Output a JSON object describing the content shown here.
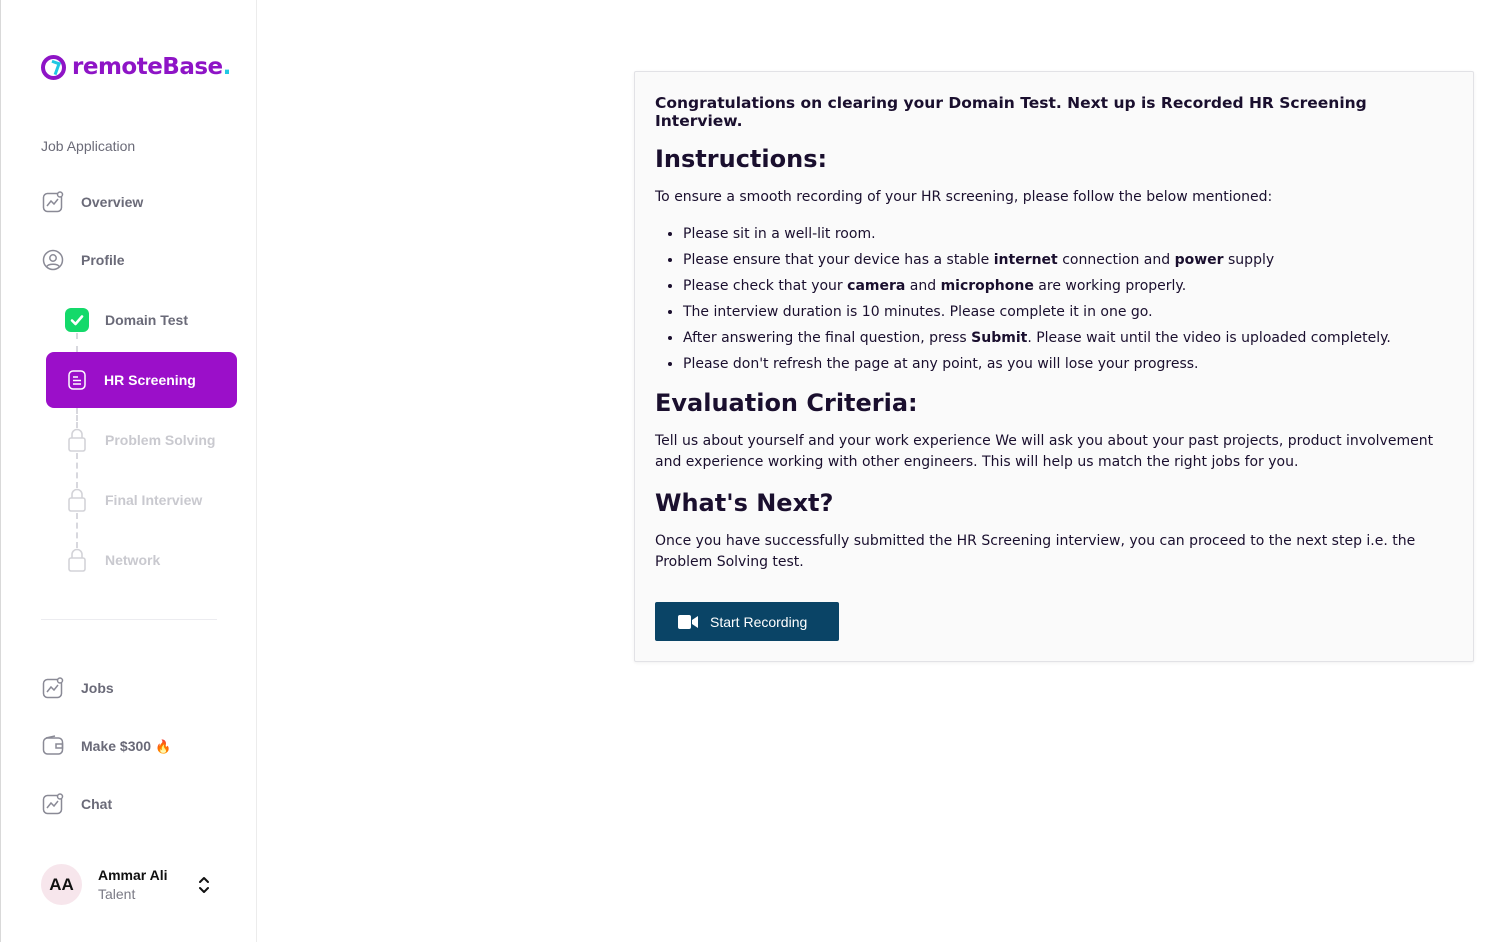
{
  "brand": {
    "name": "remoteBase",
    "dot": ".",
    "primary": "#9b0fc9",
    "accent": "#1fc8e3"
  },
  "sidebar": {
    "section_label": "Job Application",
    "top_items": [
      {
        "label": "Overview",
        "icon": "chart-icon"
      },
      {
        "label": "Profile",
        "icon": "user-circle-icon"
      }
    ],
    "steps": [
      {
        "label": "Domain Test",
        "state": "done",
        "icon": "check-icon"
      },
      {
        "label": "HR Screening",
        "state": "active",
        "icon": "document-icon"
      },
      {
        "label": "Problem Solving",
        "state": "locked",
        "icon": "lock-icon"
      },
      {
        "label": "Final Interview",
        "state": "locked",
        "icon": "lock-icon"
      },
      {
        "label": "Network",
        "state": "locked",
        "icon": "lock-icon"
      }
    ],
    "bottom_items": [
      {
        "label": "Jobs",
        "icon": "chart-icon"
      },
      {
        "label": "Make $300",
        "emoji": "🔥",
        "icon": "wallet-icon"
      },
      {
        "label": "Chat",
        "icon": "chart-icon"
      }
    ],
    "user": {
      "initials": "AA",
      "name": "Ammar Ali",
      "role": "Talent"
    }
  },
  "main": {
    "congrats": "Congratulations on clearing your Domain Test. Next up is Recorded HR Screening Interview.",
    "instructions_heading": "Instructions:",
    "instructions_intro": "To ensure a smooth recording of your HR screening, please follow the below mentioned:",
    "instructions": {
      "i1": "Please sit in a well-lit room.",
      "i2_a": "Please ensure that your device has a stable ",
      "i2_b": "internet",
      "i2_c": " connection and ",
      "i2_d": "power",
      "i2_e": " supply",
      "i3_a": "Please check that your ",
      "i3_b": "camera",
      "i3_c": " and ",
      "i3_d": "microphone",
      "i3_e": " are working properly.",
      "i4": "The interview duration is 10 minutes. Please complete it in one go.",
      "i5_a": "After answering the final question, press ",
      "i5_b": "Submit",
      "i5_c": ". Please wait until the video is uploaded completely.",
      "i6": "Please don't refresh the page at any point, as you will lose your progress."
    },
    "evaluation_heading": "Evaluation Criteria:",
    "evaluation_text": "Tell us about yourself and your work experience We will ask you about your past projects, product involvement and experience working with other engineers. This will help us match the right jobs for you.",
    "next_heading": "What's Next?",
    "next_text": "Once you have successfully submitted the HR Screening interview, you can proceed to the next step i.e. the Problem Solving test.",
    "record_button": "Start Recording"
  }
}
